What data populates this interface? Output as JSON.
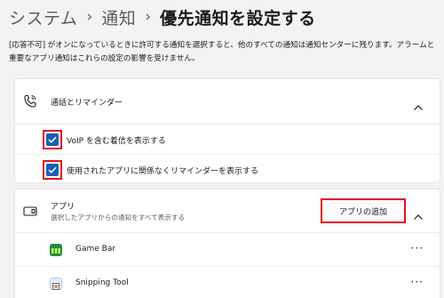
{
  "breadcrumb": {
    "items": [
      "システム",
      "通知"
    ],
    "separator": "›",
    "current": "優先通知を設定する"
  },
  "description": "[応答不可] がオンになっているときに許可する通知を選択すると、他のすべての通知は通知センターに残ります。アラームと重要なアプリ通知はこれらの設定の影響を受けません。",
  "calls_group": {
    "title": "通話とリマインダー",
    "icon": "phone-ringing-icon",
    "expanded": true,
    "options": [
      {
        "label": "VoIP を含む着信を表示する",
        "checked": true
      },
      {
        "label": "使用されたアプリに関係なくリマインダーを表示する",
        "checked": true
      }
    ]
  },
  "apps_group": {
    "title": "アプリ",
    "subtitle": "選択したアプリからの通知をすべて表示する",
    "icon": "app-window-icon",
    "add_button": "アプリの追加",
    "expanded": true,
    "apps": [
      {
        "name": "Game Bar",
        "icon": "game-bar-icon",
        "more": "···"
      },
      {
        "name": "Snipping Tool",
        "icon": "snipping-tool-icon",
        "more": "···"
      }
    ]
  },
  "colors": {
    "accent": "#1a5fb4",
    "highlight": "#e0141e"
  }
}
